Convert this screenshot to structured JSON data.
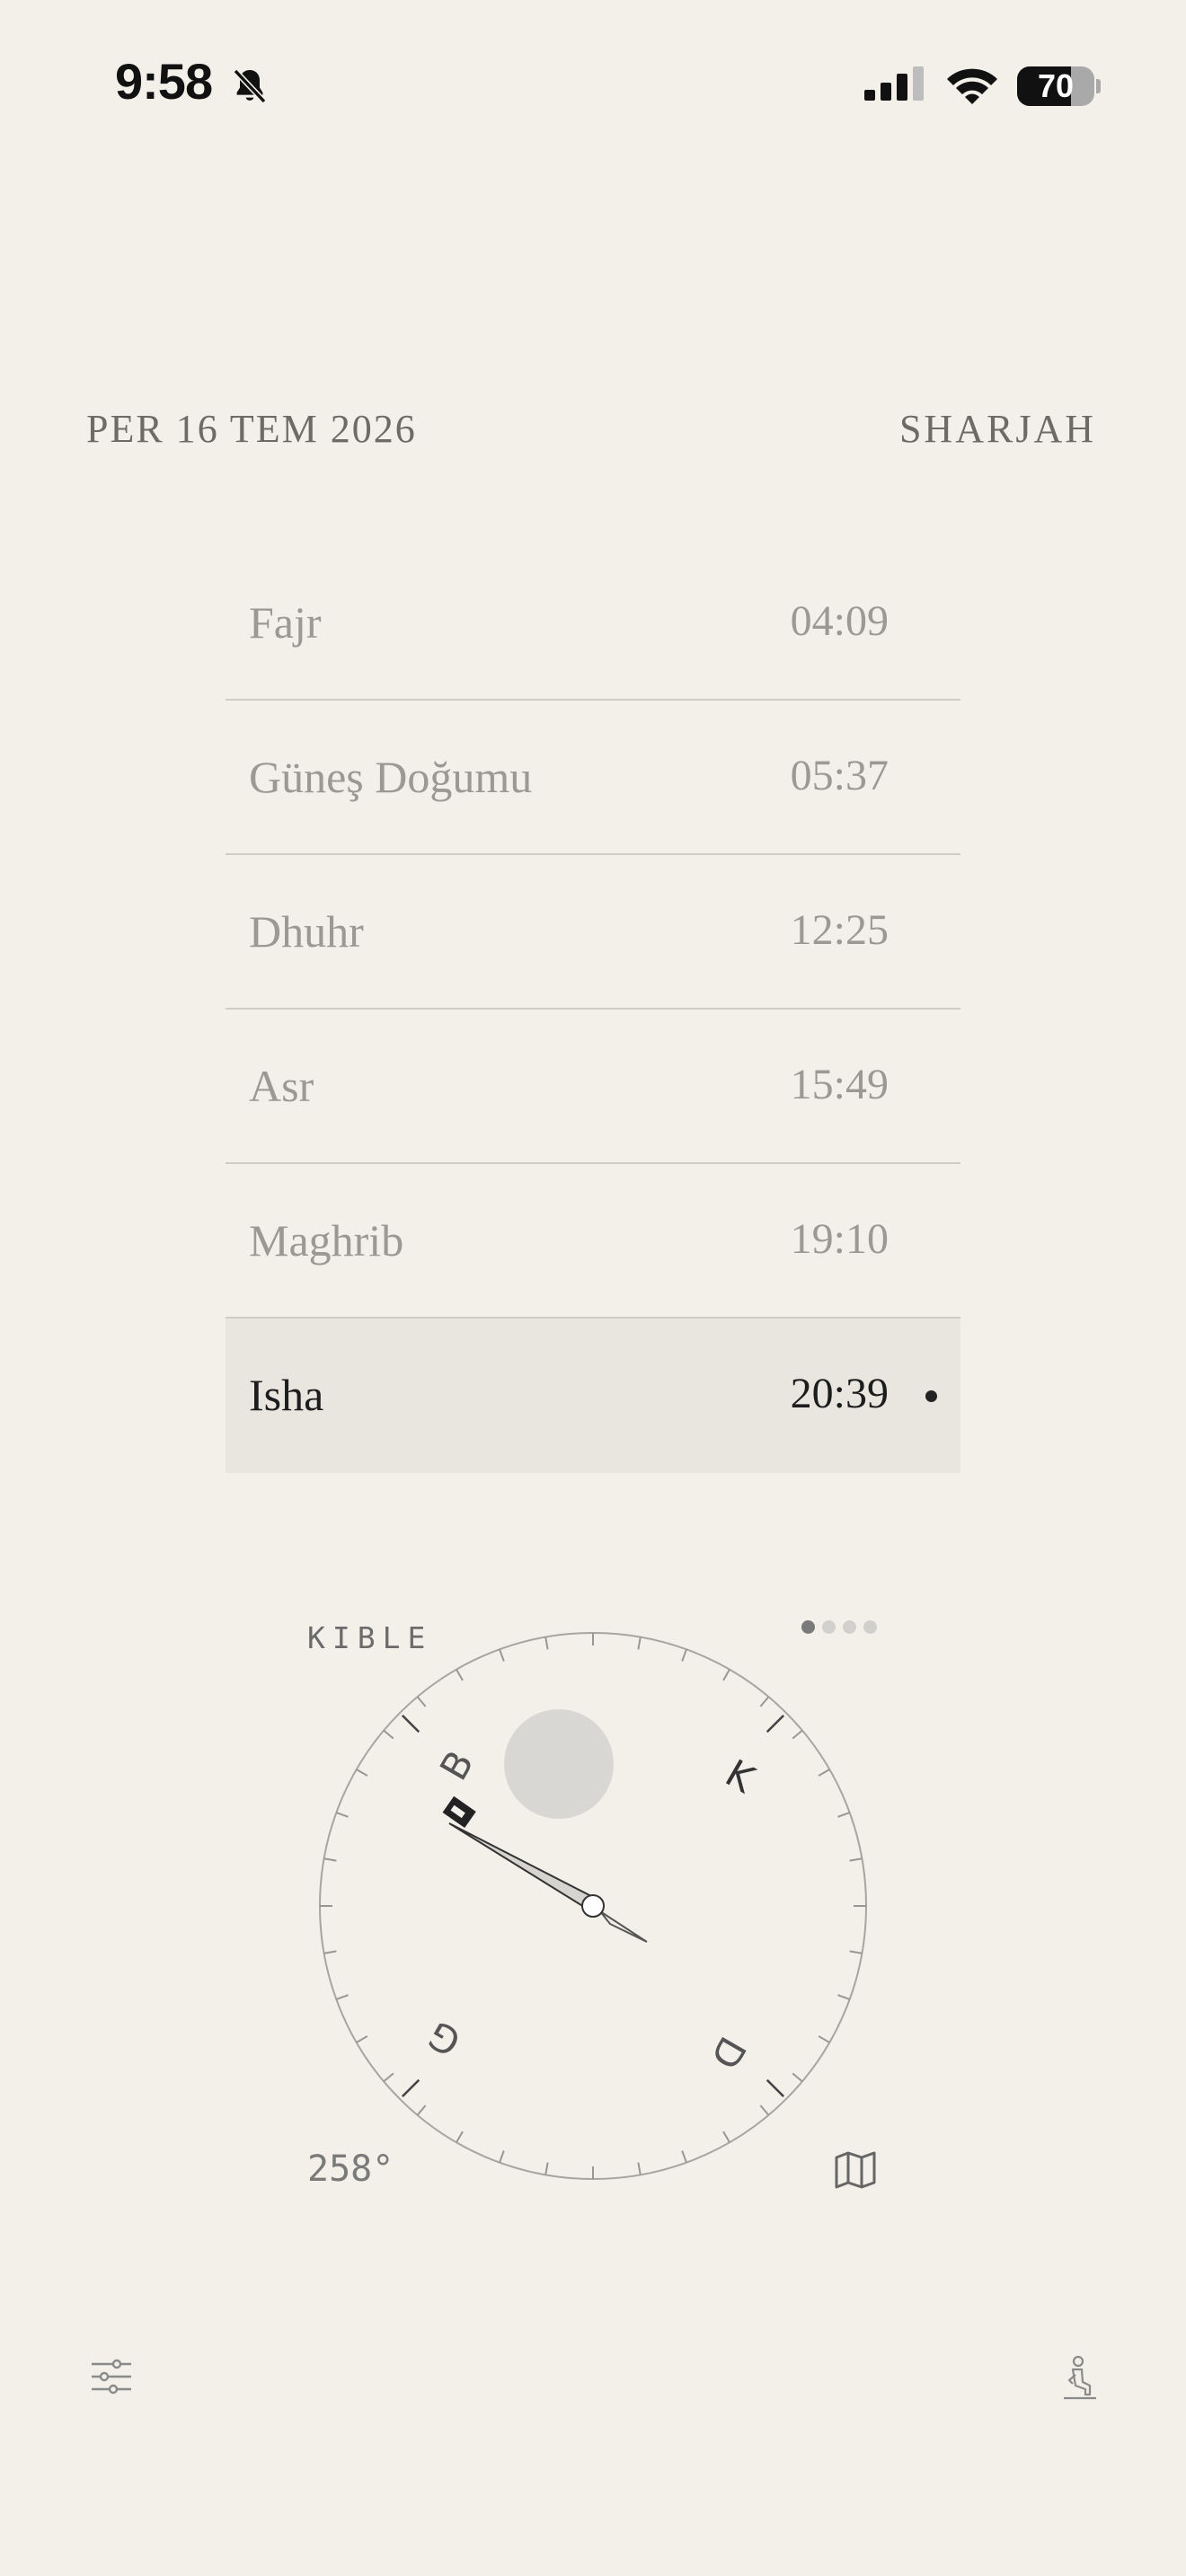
{
  "status_bar": {
    "time": "9:58",
    "battery_level": "70",
    "battery_fraction": 0.7,
    "icons": [
      "bell-slash-icon",
      "cellular-signal-icon",
      "wifi-icon",
      "battery-icon"
    ]
  },
  "header": {
    "date": "PER 16 TEM 2026",
    "city": "SHARJAH"
  },
  "prayers": [
    {
      "name": "Fajr",
      "time": "04:09",
      "active": false
    },
    {
      "name": "Güneş Doğumu",
      "time": "05:37",
      "active": false
    },
    {
      "name": "Dhuhr",
      "time": "12:25",
      "active": false
    },
    {
      "name": "Asr",
      "time": "15:49",
      "active": false
    },
    {
      "name": "Maghrib",
      "time": "19:10",
      "active": false
    },
    {
      "name": "Isha",
      "time": "20:39",
      "active": true
    }
  ],
  "qibla": {
    "label": "KIBLE",
    "degree_text": "258°",
    "heading_deg": 258,
    "directions": {
      "north": "K",
      "east": "D",
      "south": "G",
      "west": "B"
    },
    "page_dots": {
      "count": 4,
      "active_index": 0
    },
    "icons": [
      "kaaba-icon",
      "map-icon"
    ]
  },
  "bottom_bar": {
    "icons": [
      "settings-sliders-icon",
      "prayer-person-icon"
    ]
  },
  "colors": {
    "background": "#F3F0EA",
    "active_row": "#E9E6E0",
    "text_muted": "#9C9893",
    "text_active": "#1D1D1D"
  }
}
